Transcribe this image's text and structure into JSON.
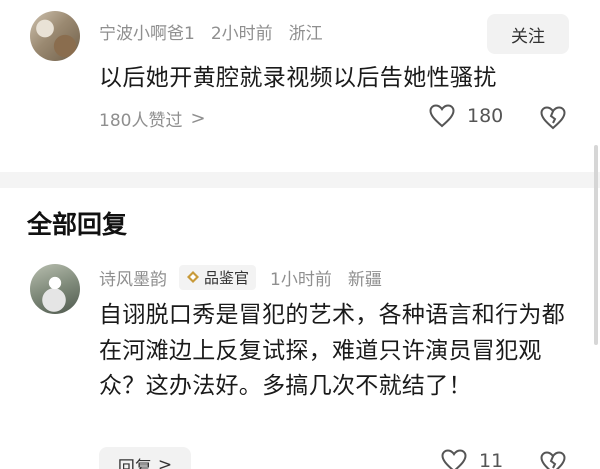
{
  "comment": {
    "username": "宁波小啊爸1",
    "time": "2小时前",
    "location": "浙江",
    "follow_label": "关注",
    "text": "以后她开黄腔就录视频以后告她性骚扰",
    "likers_label": "180人赞过",
    "likers_chevron": ">",
    "like_count": "180",
    "icons": {
      "like": "heart-icon",
      "dislike": "broken-heart-icon"
    }
  },
  "replies_section": {
    "title": "全部回复"
  },
  "reply": {
    "username": "诗风墨韵",
    "badge_label": "品鉴官",
    "badge_icon": "diamond-badge-icon",
    "time": "1小时前",
    "location": "新疆",
    "text": "自诩脱口秀是冒犯的艺术，各种语言和行为都在河滩边上反复试探，难道只许演员冒犯观众？这办法好。多搞几次不就结了！",
    "reply_button_label": "回复",
    "reply_button_chevron": ">",
    "like_count": "11"
  },
  "colors": {
    "text_primary": "#1a1a1a",
    "text_secondary": "#8f8f8f",
    "button_bg": "#f2f2f2",
    "divider": "#f4f4f4"
  }
}
